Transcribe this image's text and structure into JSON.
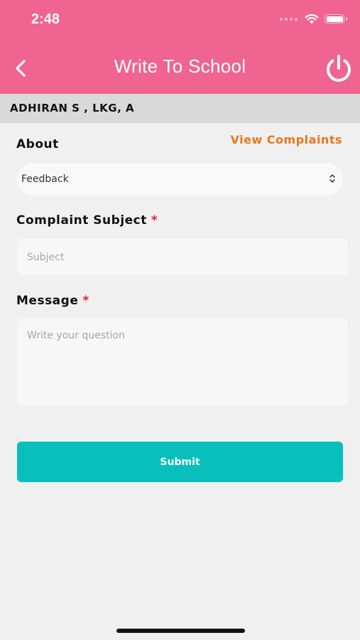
{
  "status_bar": {
    "time": "2:48"
  },
  "header": {
    "title": "Write To School",
    "back_icon": "chevron-left-icon",
    "power_icon": "power-icon"
  },
  "student": {
    "label": "ADHIRAN S , LKG, A"
  },
  "form": {
    "about_label": "About",
    "view_complaints": "View Complaints",
    "about_value": "Feedback",
    "subject_label": "Complaint Subject",
    "subject_placeholder": "Subject",
    "message_label": "Message",
    "message_placeholder": "Write your question",
    "required_mark": "*",
    "submit_label": "Submit"
  },
  "colors": {
    "header": "#ef6490",
    "accent_link": "#e8771f",
    "submit": "#08bfbd",
    "required": "#e02424"
  }
}
